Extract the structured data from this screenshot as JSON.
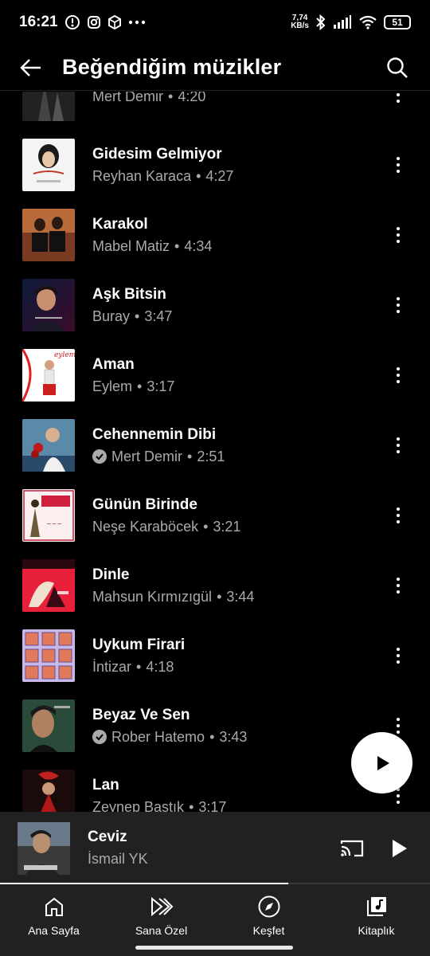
{
  "status_bar": {
    "time": "16:21",
    "net_speed_value": "7,74",
    "net_speed_unit": "KB/s",
    "battery": "51"
  },
  "header": {
    "title": "Beğendiğim müzikler"
  },
  "tracks": [
    {
      "title": "",
      "artist": "Mert Demir",
      "duration": "4:20",
      "verified": false
    },
    {
      "title": "Gidesim Gelmiyor",
      "artist": "Reyhan Karaca",
      "duration": "4:27",
      "verified": false
    },
    {
      "title": "Karakol",
      "artist": "Mabel Matiz",
      "duration": "4:34",
      "verified": false
    },
    {
      "title": "Aşk Bitsin",
      "artist": "Buray",
      "duration": "3:47",
      "verified": false
    },
    {
      "title": "Aman",
      "artist": "Eylem",
      "duration": "3:17",
      "verified": false
    },
    {
      "title": "Cehennemin Dibi",
      "artist": "Mert Demir",
      "duration": "2:51",
      "verified": true
    },
    {
      "title": "Günün Birinde",
      "artist": "Neşe Karaböcek",
      "duration": "3:21",
      "verified": false
    },
    {
      "title": "Dinle",
      "artist": "Mahsun Kırmızıgül",
      "duration": "3:44",
      "verified": false
    },
    {
      "title": "Uykum Firari",
      "artist": "İntizar",
      "duration": "4:18",
      "verified": false
    },
    {
      "title": "Beyaz Ve Sen",
      "artist": "Rober Hatemo",
      "duration": "3:43",
      "verified": true
    },
    {
      "title": "Lan",
      "artist": "Zeynep Bastık",
      "duration": "3:17",
      "verified": false
    }
  ],
  "separator": "•",
  "mini_player": {
    "title": "Ceviz",
    "artist": "İsmail YK",
    "progress": 0.67
  },
  "nav": [
    {
      "label": "Ana Sayfa",
      "icon": "home-icon"
    },
    {
      "label": "Sana Özel",
      "icon": "samples-icon"
    },
    {
      "label": "Keşfet",
      "icon": "compass-icon"
    },
    {
      "label": "Kitaplık",
      "icon": "library-icon"
    }
  ],
  "colors": {
    "background": "#000000",
    "surface": "#212121",
    "text_secondary": "#aaaaaa"
  }
}
